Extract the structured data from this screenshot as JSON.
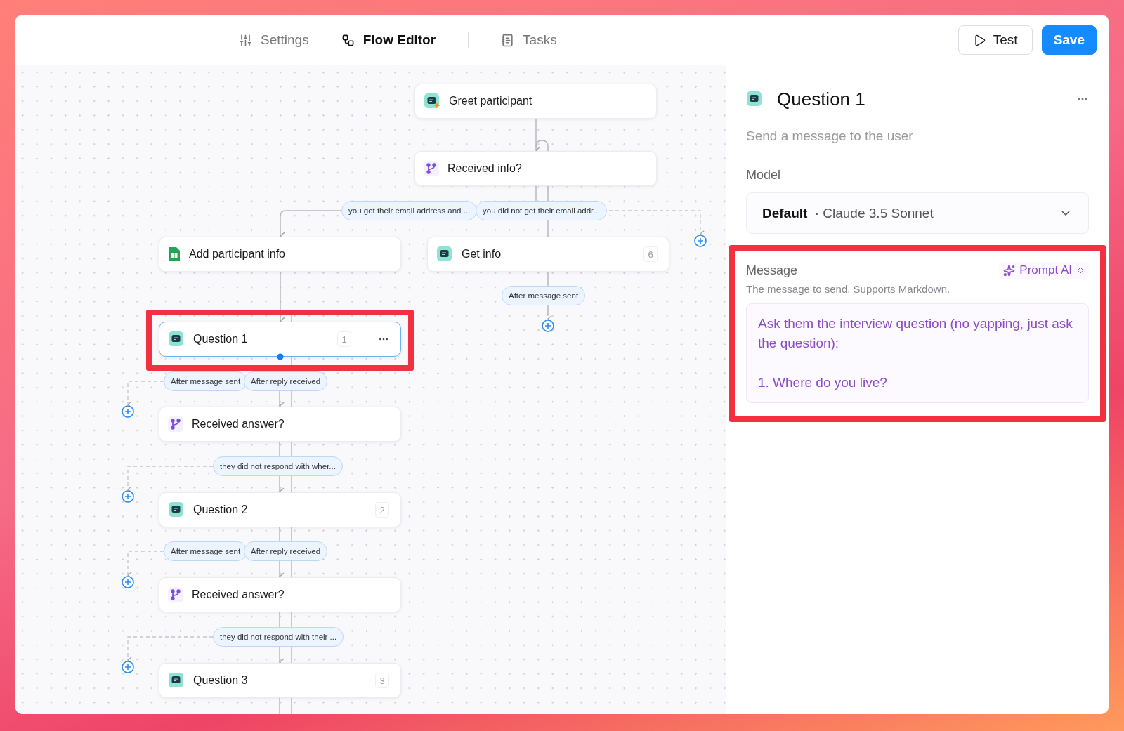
{
  "nav_tabs": [
    {
      "label": "Settings",
      "selected": false
    },
    {
      "label": "Flow Editor",
      "selected": true
    },
    {
      "label": "Tasks",
      "selected": false
    }
  ],
  "actions": [
    {
      "label": "Test",
      "kind": "secondary"
    },
    {
      "label": "Save",
      "kind": "primary"
    }
  ],
  "canvas": {
    "nodes": [
      {
        "label": "Greet participant",
        "kind": "ai_message",
        "selected": false,
        "highlighted": false
      },
      {
        "label": "Received info?",
        "kind": "branch",
        "selected": false,
        "highlighted": false
      },
      {
        "label": "Add participant info",
        "kind": "sheet",
        "selected": false,
        "highlighted": false
      },
      {
        "label": "Get info",
        "kind": "message",
        "badge": "6",
        "selected": false,
        "highlighted": false
      },
      {
        "label": "Question 1",
        "kind": "message",
        "badge": "1",
        "selected": true,
        "highlighted": true
      },
      {
        "label": "Received answer?",
        "kind": "branch",
        "selected": false,
        "highlighted": false
      },
      {
        "label": "Question 2",
        "kind": "message",
        "badge": "2",
        "selected": false,
        "highlighted": false
      },
      {
        "label": "Received answer?",
        "kind": "branch",
        "selected": false,
        "highlighted": false
      },
      {
        "label": "Question 3",
        "kind": "message",
        "badge": "3",
        "selected": false,
        "highlighted": false
      }
    ],
    "edge_labels": [
      {
        "text": "you got their email address and ..."
      },
      {
        "text": "you did not get their email addr..."
      },
      {
        "text": "After message sent"
      },
      {
        "text": "After message sent"
      },
      {
        "text": "After reply received"
      },
      {
        "text": "they did not respond with wher..."
      },
      {
        "text": "After message sent"
      },
      {
        "text": "After reply received"
      },
      {
        "text": "they did not respond with their ..."
      }
    ]
  },
  "panel": {
    "title": "Question 1",
    "subtitle": "Send a message to the user",
    "model_label": "Model",
    "model": {
      "name": "Default",
      "separator": "·",
      "value": "Claude 3.5 Sonnet"
    },
    "message": {
      "label": "Message",
      "hint": "The message to send. Supports Markdown.",
      "prompt_ai": "Prompt AI",
      "value": "Ask them the interview question (no yapping, just ask the question):\n\n1. Where do you live?",
      "highlighted": true
    }
  }
}
